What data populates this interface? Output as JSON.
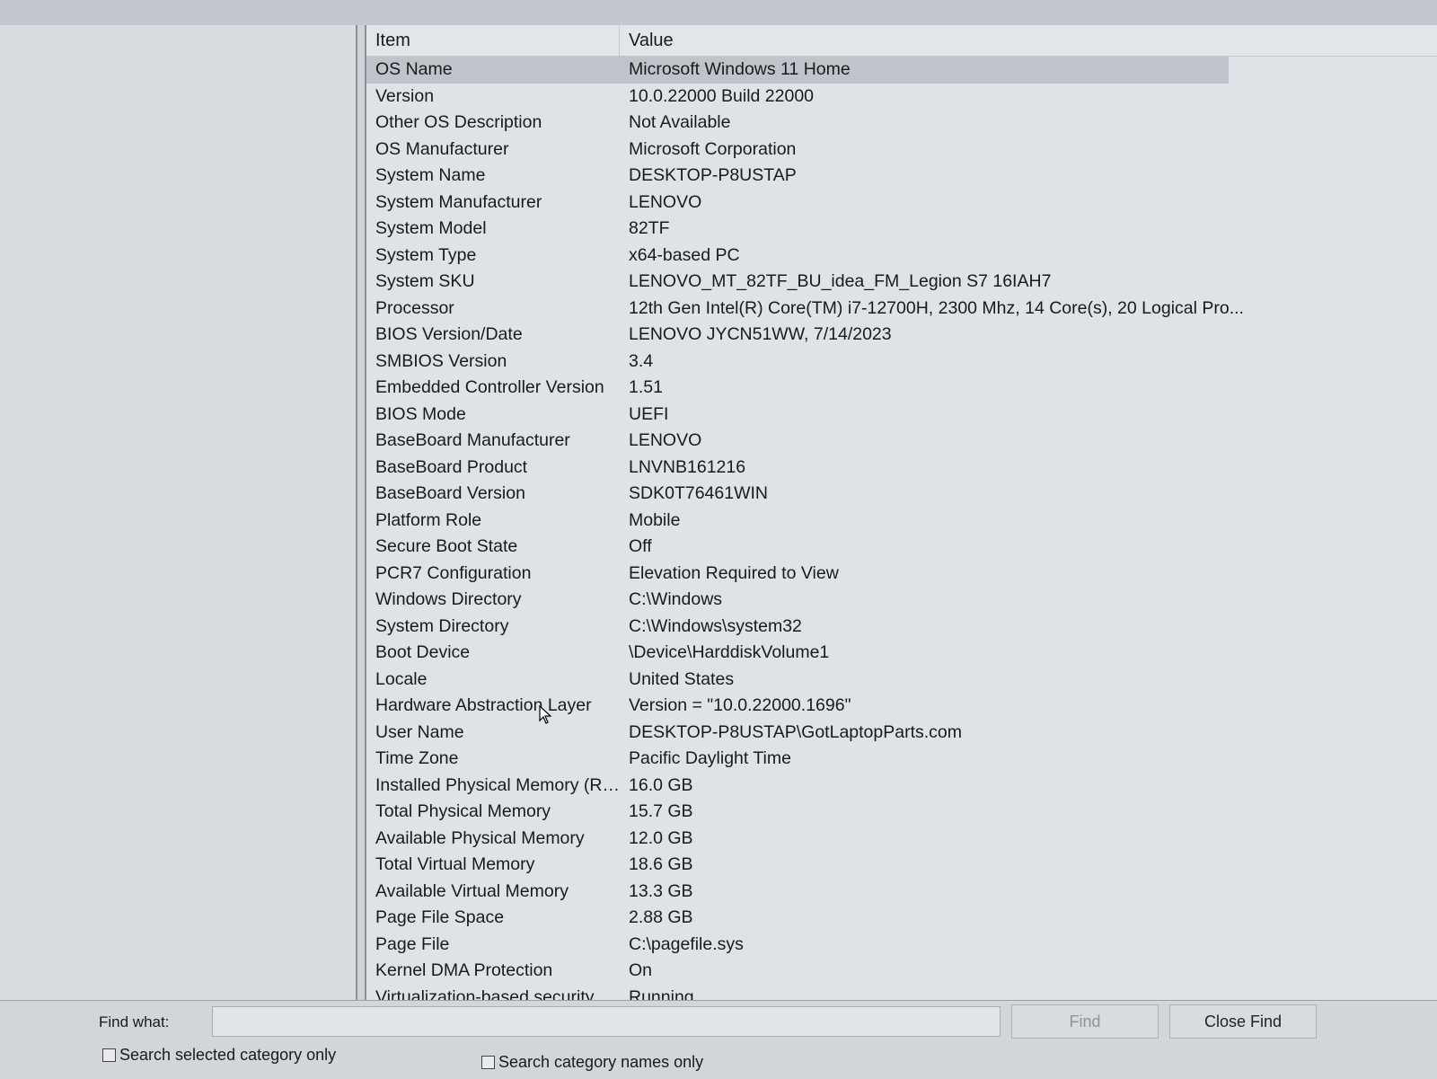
{
  "list": {
    "columns": {
      "item": "Item",
      "value": "Value"
    },
    "rows": [
      {
        "item": "OS Name",
        "value": "Microsoft Windows 11 Home"
      },
      {
        "item": "Version",
        "value": "10.0.22000 Build 22000"
      },
      {
        "item": "Other OS Description",
        "value": "Not Available"
      },
      {
        "item": "OS Manufacturer",
        "value": "Microsoft Corporation"
      },
      {
        "item": "System Name",
        "value": "DESKTOP-P8USTAP"
      },
      {
        "item": "System Manufacturer",
        "value": "LENOVO"
      },
      {
        "item": "System Model",
        "value": "82TF"
      },
      {
        "item": "System Type",
        "value": "x64-based PC"
      },
      {
        "item": "System SKU",
        "value": "LENOVO_MT_82TF_BU_idea_FM_Legion S7 16IAH7"
      },
      {
        "item": "Processor",
        "value": "12th Gen Intel(R) Core(TM) i7-12700H, 2300 Mhz, 14 Core(s), 20 Logical Pro..."
      },
      {
        "item": "BIOS Version/Date",
        "value": "LENOVO JYCN51WW, 7/14/2023"
      },
      {
        "item": "SMBIOS Version",
        "value": "3.4"
      },
      {
        "item": "Embedded Controller Version",
        "value": "1.51"
      },
      {
        "item": "BIOS Mode",
        "value": "UEFI"
      },
      {
        "item": "BaseBoard Manufacturer",
        "value": "LENOVO"
      },
      {
        "item": "BaseBoard Product",
        "value": "LNVNB161216"
      },
      {
        "item": "BaseBoard Version",
        "value": "SDK0T76461WIN"
      },
      {
        "item": "Platform Role",
        "value": "Mobile"
      },
      {
        "item": "Secure Boot State",
        "value": "Off"
      },
      {
        "item": "PCR7 Configuration",
        "value": "Elevation Required to View"
      },
      {
        "item": "Windows Directory",
        "value": "C:\\Windows"
      },
      {
        "item": "System Directory",
        "value": "C:\\Windows\\system32"
      },
      {
        "item": "Boot Device",
        "value": "\\Device\\HarddiskVolume1"
      },
      {
        "item": "Locale",
        "value": "United States"
      },
      {
        "item": "Hardware Abstraction Layer",
        "value": "Version = \"10.0.22000.1696\""
      },
      {
        "item": "User Name",
        "value": "DESKTOP-P8USTAP\\GotLaptopParts.com"
      },
      {
        "item": "Time Zone",
        "value": "Pacific Daylight Time"
      },
      {
        "item": "Installed Physical Memory (RA...",
        "value": "16.0 GB"
      },
      {
        "item": "Total Physical Memory",
        "value": "15.7 GB"
      },
      {
        "item": "Available Physical Memory",
        "value": "12.0 GB"
      },
      {
        "item": "Total Virtual Memory",
        "value": "18.6 GB"
      },
      {
        "item": "Available Virtual Memory",
        "value": "13.3 GB"
      },
      {
        "item": "Page File Space",
        "value": "2.88 GB"
      },
      {
        "item": "Page File",
        "value": "C:\\pagefile.sys"
      },
      {
        "item": "Kernel DMA Protection",
        "value": "On"
      },
      {
        "item": "Virtualization-based security",
        "value": "Running"
      }
    ]
  },
  "find": {
    "label": "Find what:",
    "input_value": "",
    "find_button": "Find",
    "close_button": "Close Find",
    "checkbox_selected_category": "Search selected category only",
    "checkbox_category_names": "Search category names only"
  },
  "colors": {
    "selection": "#bfc4ca",
    "pane_bg": "#dfe2e6"
  },
  "icons": {
    "cursor": "mouse-pointer-icon"
  }
}
